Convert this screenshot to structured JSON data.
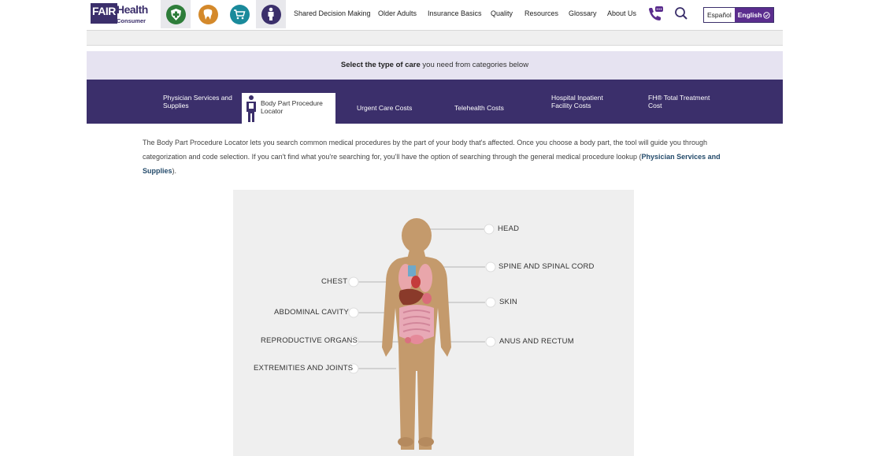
{
  "logo": {
    "fair": "FAIR",
    "health": "Health",
    "consumer": "Consumer"
  },
  "categories": [
    {
      "icon": "medical-plus-icon",
      "color": "#2e7d3a"
    },
    {
      "icon": "tooth-icon",
      "color": "#d4892b"
    },
    {
      "icon": "cart-icon",
      "color": "#1a8a9b"
    },
    {
      "icon": "person-icon",
      "color": "#3b2f6b"
    }
  ],
  "nav": [
    "Shared Decision Making",
    "Older Adults",
    "Insurance Basics",
    "Quality",
    "Resources",
    "Glossary",
    "About Us"
  ],
  "lang": {
    "es": "Español",
    "en": "English"
  },
  "select_bar": {
    "bold": "Select the type of care",
    "rest": " you need from categories below"
  },
  "tabs": [
    {
      "line1": "Physician Services and",
      "line2": "Supplies"
    },
    {
      "line1": "Body Part Procedure",
      "line2": "Locator"
    },
    {
      "line1": "Urgent Care Costs",
      "line2": ""
    },
    {
      "line1": "Telehealth Costs",
      "line2": ""
    },
    {
      "line1": "Hospital Inpatient",
      "line2": "Facility Costs"
    },
    {
      "line1": "FH® Total Treatment",
      "line2": "Cost"
    }
  ],
  "intro": {
    "text": "The Body Part Procedure Locator lets you search common medical procedures by the part of your body that's affected. Once you choose a body part, the tool will guide you through categorization and code selection. If you can't find what you're searching for, you'll have the option of searching through the general medical procedure lookup (",
    "link": "Physician Services and Supplies",
    "end": ")."
  },
  "body_labels": {
    "head": "HEAD",
    "spine": "SPINE AND SPINAL CORD",
    "chest": "CHEST",
    "skin": "SKIN",
    "abdominal": "ABDOMINAL CAVITY",
    "reproductive": "REPRODUCTIVE ORGANS",
    "anus": "ANUS AND RECTUM",
    "extremities": "EXTREMITIES AND JOINTS"
  },
  "colors": {
    "brand": "#3b2f6b",
    "accent": "#5b2d8e",
    "skin": "#c49a6c"
  }
}
